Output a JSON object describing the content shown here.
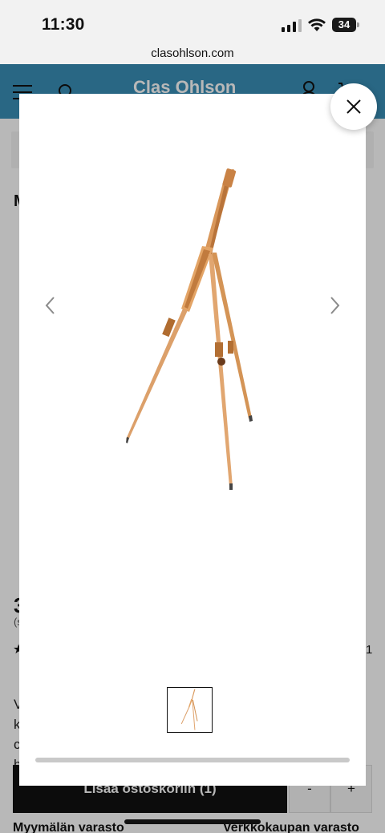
{
  "status_bar": {
    "time": "11:30",
    "battery": "34"
  },
  "browser": {
    "url": "clasohlson.com"
  },
  "site": {
    "logo": "Clas Ohlson",
    "title_initial": "M",
    "price_initial": "3",
    "price_sub": "(s",
    "rating_star": "★",
    "rating_count_fragment": "1",
    "description_lines": [
      "V",
      "k",
      "c",
      "h"
    ],
    "add_to_cart": "Lisää ostoskoriin (1)",
    "qty_minus": "-",
    "qty_plus": "+",
    "stock_store": "Myymälän varasto",
    "stock_online": "Verkkokaupan varasto"
  },
  "gallery": {
    "product_image": "easel",
    "image_count": 1,
    "selected_index": 0
  },
  "colors": {
    "header": "#3a8fb7",
    "easel_wood": "#d9975a",
    "overlay": "rgba(0,0,0,0.28)"
  },
  "icons": [
    "menu-icon",
    "search-icon",
    "user-icon",
    "cart-icon",
    "close-icon",
    "chevron-left-icon",
    "chevron-right-icon"
  ]
}
